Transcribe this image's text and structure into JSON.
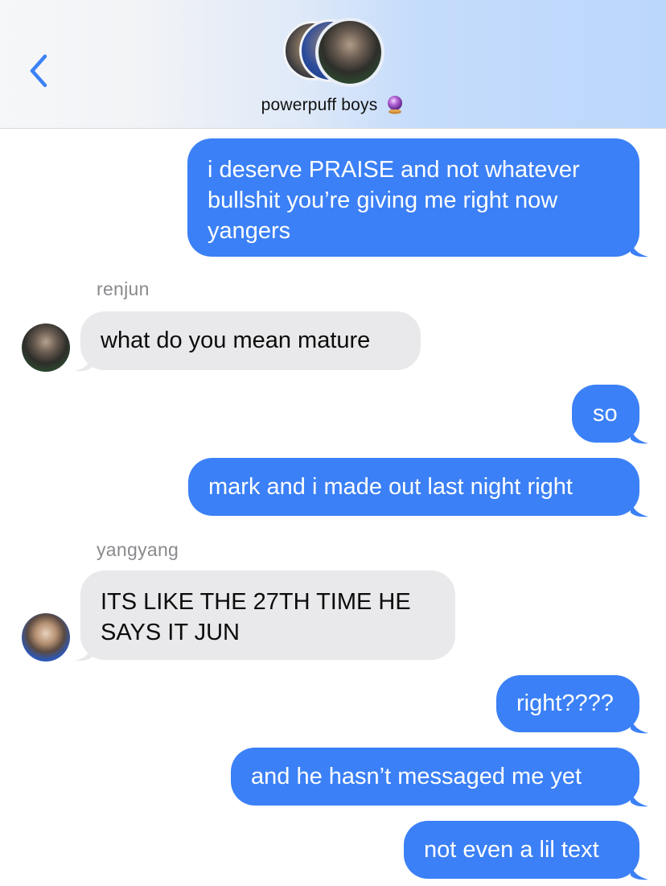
{
  "header": {
    "group_name": "powerpuff boys",
    "group_emoji": "crystal-ball-icon",
    "back_icon": "chevron-left-icon"
  },
  "messages": [
    {
      "type": "outgoing",
      "text_lines": [
        "i deserve PRAISE and not whatever",
        "bullshit you’re giving me right now",
        "yangers"
      ]
    },
    {
      "type": "sender",
      "text": "renjun"
    },
    {
      "type": "incoming",
      "text_lines": [
        "what do you mean mature"
      ]
    },
    {
      "type": "outgoing",
      "text_lines": [
        "so"
      ]
    },
    {
      "type": "outgoing",
      "text_lines": [
        "mark and i made out last night right"
      ]
    },
    {
      "type": "sender",
      "text": "yangyang"
    },
    {
      "type": "incoming",
      "text_lines": [
        "ITS LIKE THE 27TH TIME HE",
        "SAYS IT JUN"
      ]
    },
    {
      "type": "outgoing",
      "text_lines": [
        "right????"
      ]
    },
    {
      "type": "outgoing",
      "text_lines": [
        "and he hasn’t messaged me yet"
      ]
    },
    {
      "type": "outgoing",
      "text_lines": [
        "not even a lil text"
      ]
    }
  ],
  "colors": {
    "outgoing_bubble": "#3b80f6",
    "incoming_bubble": "#e9e9eb",
    "sender_label": "#8a8a8e",
    "back_chevron": "#3b82f6"
  }
}
